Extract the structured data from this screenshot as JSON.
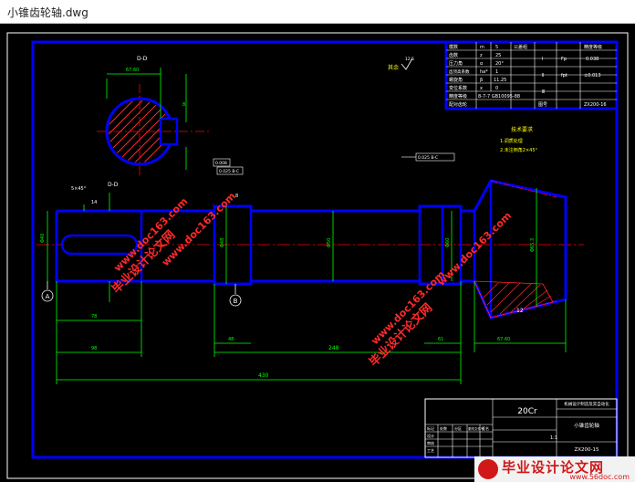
{
  "window": {
    "title": "小锥齿轮轴.dwg"
  },
  "colors": {
    "background": "#000000",
    "frame": "#0000ff",
    "outline": "#0000ff",
    "dimension": "#00ff00",
    "center": "#ff0000",
    "text": "#ffffff"
  },
  "drawing": {
    "dims": {
      "total_length": "430",
      "len_248": "248",
      "len_78": "78",
      "len_98": "98",
      "len_48": "48",
      "len_61": "61",
      "len_67": "67.60",
      "dia_40": "Φ40",
      "dia_48": "Φ48",
      "dia_50": "Φ50",
      "dia_60": "Φ60",
      "dia_65": "Φ65.3",
      "key": "14",
      "key2": "8",
      "chamfer": "5×45°",
      "angle": "12",
      "sect_d": "D-D",
      "datum_a": "A",
      "datum_b": "B",
      "tol1": "0.025 B-C",
      "tol2": "0.008",
      "tol3": "0.025 B-C",
      "rough": "其余",
      "rough_val": "12.5"
    },
    "section_label": "D-D",
    "tech_req_title": "技术要求",
    "tech_req_lines": [
      "1.调质处理",
      "2.未注倒角2×45°"
    ]
  },
  "param_table": {
    "rows": [
      [
        "模数",
        "m",
        "5",
        "公差组",
        "精度等级"
      ],
      [
        "齿数",
        "z",
        "25",
        "Ⅰ",
        "Fp",
        "0.038"
      ],
      [
        "压力角",
        "α",
        "20°",
        "Ⅱ",
        "fpt",
        "±0.013"
      ],
      [
        "齿顶高系数",
        "ha*",
        "1",
        "Ⅲ",
        "",
        ""
      ],
      [
        "螺旋角",
        "β",
        "11.25",
        "",
        "",
        ""
      ],
      [
        "变位系数",
        "x",
        "0",
        "",
        "",
        ""
      ],
      [
        "精度等级",
        "8-7-7 GB10095-88",
        "",
        "",
        "",
        ""
      ],
      [
        "配对齿轮",
        "",
        "",
        "图号",
        "ZX200-16",
        ""
      ]
    ]
  },
  "title_block": {
    "material": "20Cr",
    "school": "机械设计制造及其自动化",
    "part_name": "小锥齿轮轴",
    "scale": "1:1",
    "drawing_no": "ZX200-15",
    "rows": [
      "标记",
      "处数",
      "分区",
      "更改文件号",
      "签名",
      "日期"
    ],
    "labels": [
      "设计",
      "审核",
      "工艺",
      "批准"
    ]
  },
  "watermarks": {
    "text1": "毕业设计论文网",
    "url1": "www.doc163.com",
    "footer_cn": "毕业设计论文网",
    "footer_url": "www.56doc.com"
  }
}
